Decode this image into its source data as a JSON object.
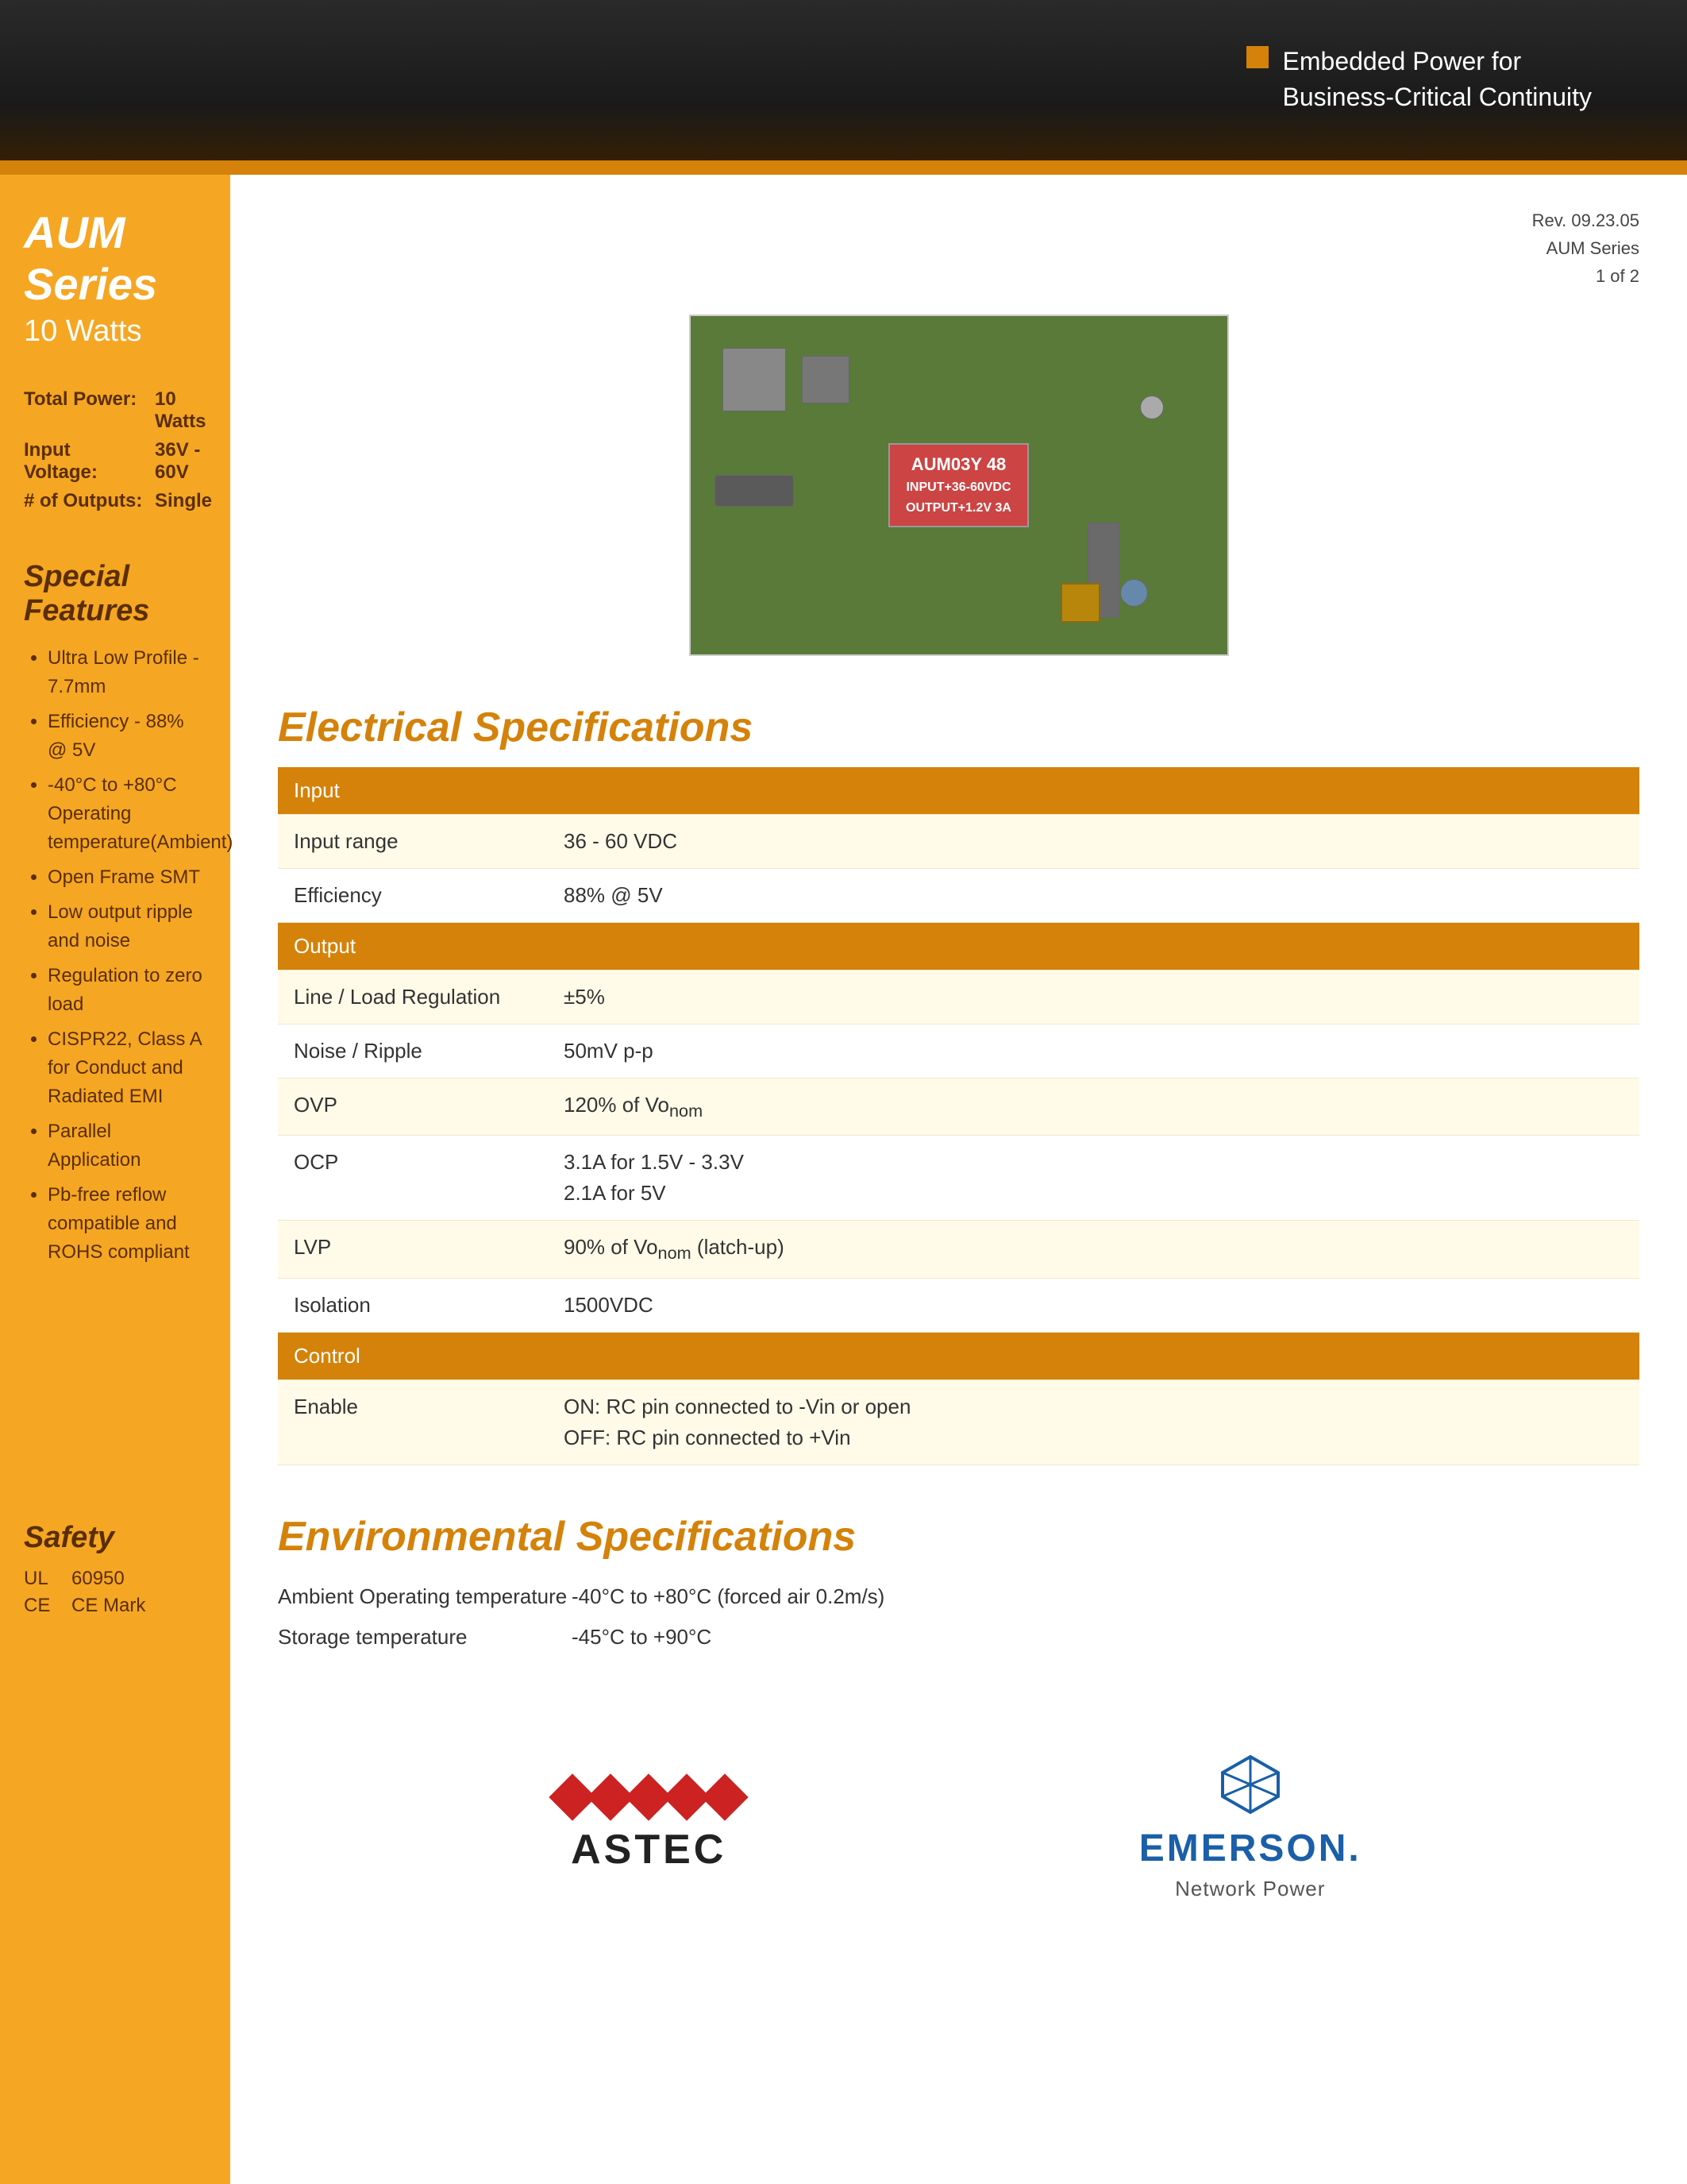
{
  "header": {
    "tagline_line1": "Embedded Power for",
    "tagline_line2": "Business-Critical Continuity"
  },
  "rev_info": {
    "rev": "Rev. 09.23.05",
    "series": "AUM Series",
    "page": "1 of 2"
  },
  "sidebar": {
    "series_title": "AUM Series",
    "watts": "10 Watts",
    "specs": [
      {
        "label": "Total Power:",
        "value": "10 Watts"
      },
      {
        "label": "Input Voltage:",
        "value": "36V - 60V"
      },
      {
        "label": "# of Outputs:",
        "value": "Single"
      }
    ],
    "special_features_title": "Special Features",
    "features": [
      "Ultra Low Profile - 7.7mm",
      "Efficiency - 88% @ 5V",
      "-40°C to +80°C Operating temperature(Ambient)",
      "Open Frame SMT",
      "Low output ripple and noise",
      "Regulation to zero load",
      "CISPR22, Class A for Conduct and Radiated EMI",
      "Parallel Application",
      "Pb-free reflow compatible and ROHS compliant"
    ],
    "safety_title": "Safety",
    "safety_items": [
      {
        "label": "UL",
        "value": "60950"
      },
      {
        "label": "CE",
        "value": "CE Mark"
      }
    ]
  },
  "electrical_specs": {
    "section_title": "Electrical Specifications",
    "input_header": "Input",
    "output_header": "Output",
    "control_header": "Control",
    "rows": [
      {
        "section": "input",
        "label": "Input range",
        "value": "36 - 60 VDC",
        "bg": "light"
      },
      {
        "section": "input",
        "label": "Efficiency",
        "value": "88% @ 5V",
        "bg": "white"
      },
      {
        "section": "output",
        "label": "Line / Load Regulation",
        "value": "±5%",
        "bg": "light"
      },
      {
        "section": "output",
        "label": "Noise / Ripple",
        "value": "50mV p-p",
        "bg": "white"
      },
      {
        "section": "output",
        "label": "OVP",
        "value": "120% of Vonom",
        "bg": "light"
      },
      {
        "section": "output",
        "label": "OCP",
        "value": "3.1A for 1.5V - 3.3V\n2.1A for 5V",
        "bg": "white"
      },
      {
        "section": "output",
        "label": "LVP",
        "value": "90% of Vonom (latch-up)",
        "bg": "light"
      },
      {
        "section": "output",
        "label": "Isolation",
        "value": "1500VDC",
        "bg": "white"
      },
      {
        "section": "control",
        "label": "Enable",
        "value": "ON: RC pin connected to -Vin or open\nOFF: RC pin connected to +Vin",
        "bg": "light"
      }
    ]
  },
  "environmental_specs": {
    "section_title": "Environmental Specifications",
    "rows": [
      {
        "label": "Ambient Operating temperature",
        "value": "-40°C to +80°C (forced air 0.2m/s)"
      },
      {
        "label": "Storage temperature",
        "value": "-45°C to +90°C"
      }
    ]
  },
  "product_image_alt": "AUM Series PCB Module",
  "astec_logo_text": "ASTEC",
  "emerson_logo_text": "EMERSON.",
  "emerson_sub_text": "Network Power"
}
